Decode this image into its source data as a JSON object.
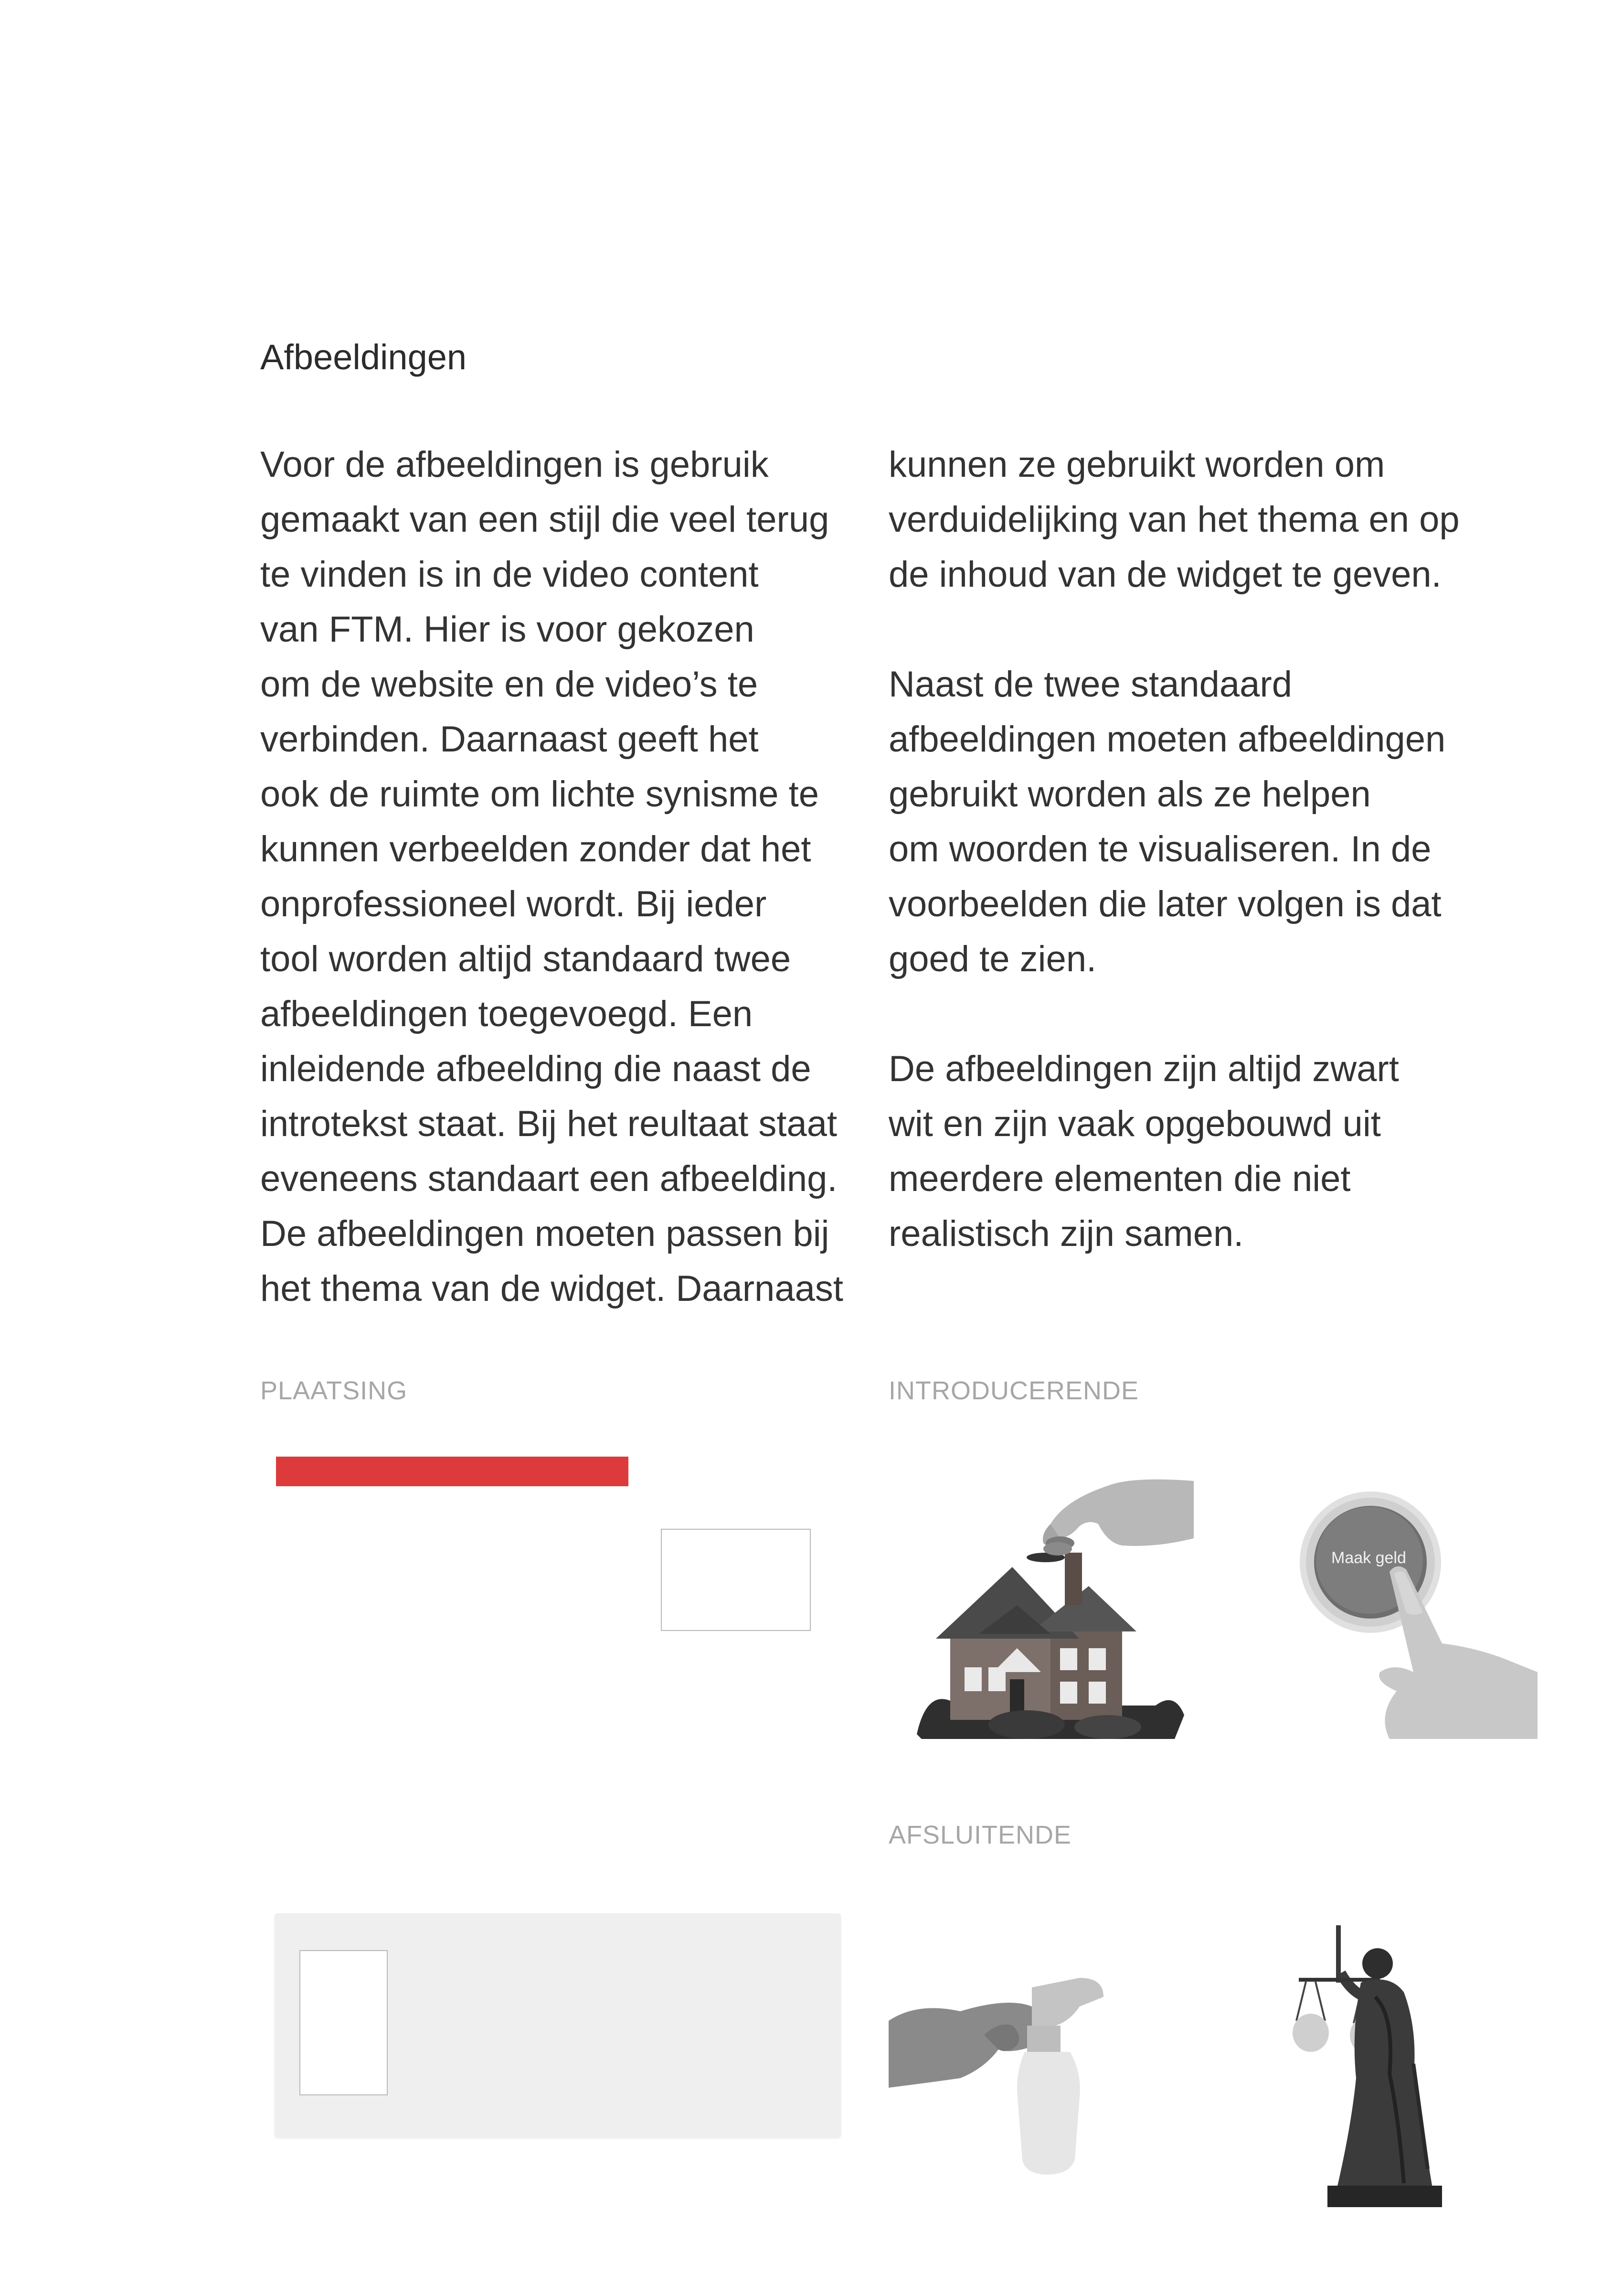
{
  "section": {
    "title": "Afbeeldingen"
  },
  "left_column": {
    "lines": [
      "Voor de afbeeldingen is gebruik",
      "gemaakt van een stijl die veel terug",
      "te vinden is in de video content",
      "van FTM. Hier is voor gekozen",
      "om de website en de video’s te",
      "verbinden. Daarnaast geeft het",
      "ook de ruimte om lichte synisme te",
      "kunnen verbeelden zonder dat het",
      "onprofessioneel wordt. Bij ieder",
      "tool worden altijd standaard twee",
      "afbeeldingen toegevoegd. Een",
      "inleidende afbeelding die naast de",
      "introtekst staat. Bij het reultaat staat",
      "eveneens standaart een afbeelding.",
      "De afbeeldingen moeten passen bij",
      "het thema van de widget. Daarnaast"
    ]
  },
  "right_column": {
    "paragraphs": [
      [
        "kunnen ze gebruikt worden om",
        "verduidelijking van het thema en op",
        "de inhoud van de widget te geven."
      ],
      [
        "Naast de twee standaard",
        "afbeeldingen moeten afbeeldingen",
        "gebruikt worden als ze helpen",
        "om woorden te visualiseren. In de",
        "voorbeelden die later volgen is dat",
        "goed te zien."
      ],
      [
        "De afbeeldingen zijn altijd zwart",
        "wit en zijn vaak opgebouwd uit",
        "meerdere elementen die niet",
        "realistisch zijn samen."
      ]
    ]
  },
  "labels": {
    "placement": "PLAATSING",
    "intro": "INTRODUCERENDE",
    "closing": "AFSLUITENDE"
  },
  "button_image_text": "Maak geld",
  "colors": {
    "accent_red": "#dd3b3b",
    "label_gray": "#a6a6a6",
    "panel_gray": "#efefef"
  },
  "images": {
    "intro": [
      "hand-dropping-coin-on-house",
      "finger-pressing-red-button"
    ],
    "closing": [
      "gloved-hand-with-spray-bottle",
      "lady-justice-statue"
    ]
  }
}
